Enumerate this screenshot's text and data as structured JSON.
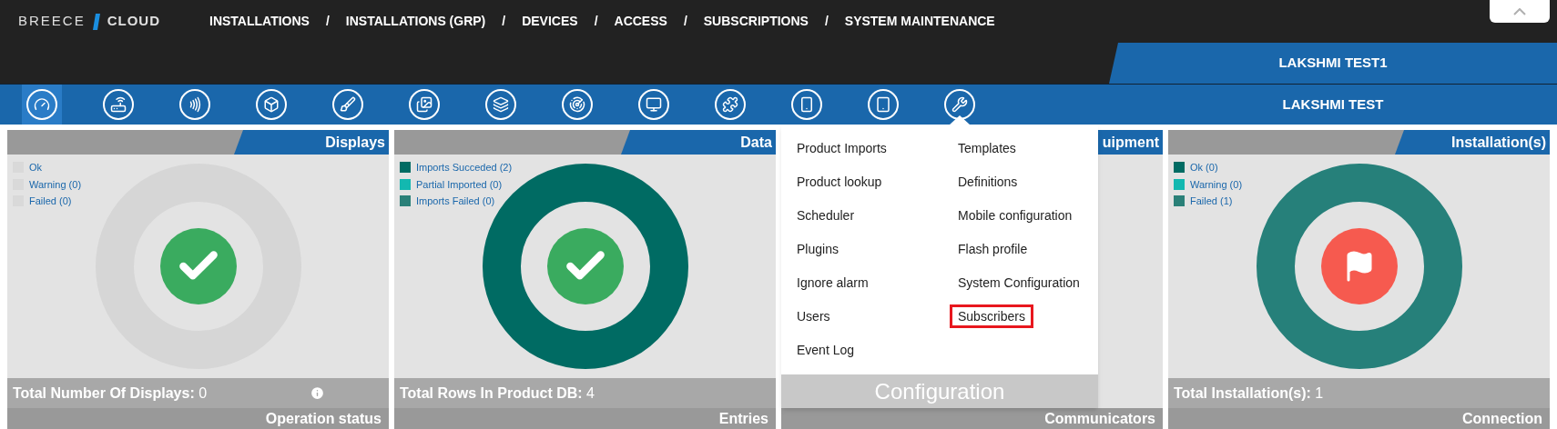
{
  "logo": {
    "left": "BREECE",
    "right": "CLOUD"
  },
  "nav": {
    "separator": "/",
    "items": [
      "INSTALLATIONS",
      "INSTALLATIONS (GRP)",
      "DEVICES",
      "ACCESS",
      "SUBSCRIPTIONS",
      "SYSTEM MAINTENANCE"
    ]
  },
  "account": {
    "group": "LAKSHMI TEST1",
    "site": "LAKSHMI TEST"
  },
  "toolbar": [
    {
      "kind": "gauge",
      "selected": true,
      "expanded": false
    },
    {
      "kind": "router",
      "selected": false,
      "expanded": false
    },
    {
      "kind": "nfc",
      "selected": false,
      "expanded": false
    },
    {
      "kind": "box",
      "selected": false,
      "expanded": false
    },
    {
      "kind": "brush",
      "selected": false,
      "expanded": false
    },
    {
      "kind": "images",
      "selected": false,
      "expanded": false
    },
    {
      "kind": "layers",
      "selected": false,
      "expanded": false
    },
    {
      "kind": "radar",
      "selected": false,
      "expanded": false
    },
    {
      "kind": "monitor",
      "selected": false,
      "expanded": false
    },
    {
      "kind": "puzzle",
      "selected": false,
      "expanded": false
    },
    {
      "kind": "phone",
      "selected": false,
      "expanded": false
    },
    {
      "kind": "tablet",
      "selected": false,
      "expanded": false
    },
    {
      "kind": "wrench",
      "selected": false,
      "expanded": true
    }
  ],
  "cards": [
    {
      "title": "Displays",
      "color": "#d6d6d6",
      "kind": "check",
      "legend": [
        {
          "label": "Ok",
          "color": "#d9d9d9"
        },
        {
          "label": "Warning (0)",
          "color": "#d9d9d9"
        },
        {
          "label": "Failed (0)",
          "color": "#d9d9d9"
        }
      ],
      "total_label": "Total Number Of Displays:",
      "total_value": "0",
      "info": true,
      "footer": "Operation status"
    },
    {
      "title": "Data",
      "color": "#006b63",
      "kind": "check",
      "legend": [
        {
          "label": "Imports Succeded (2)",
          "color": "#006b63"
        },
        {
          "label": "Partial Imported (0)",
          "color": "#13b8b0"
        },
        {
          "label": "Imports Failed (0)",
          "color": "#2a8078"
        }
      ],
      "total_label": "Total Rows In Product DB:",
      "total_value": "4",
      "info": false,
      "footer": "Entries"
    },
    {
      "title": "uipment",
      "footer": "Communicators"
    },
    {
      "title": "Installation(s)",
      "color": "#26807a",
      "kind": "flag",
      "legend": [
        {
          "label": "Ok (0)",
          "color": "#006b63"
        },
        {
          "label": "Warning (0)",
          "color": "#13b8b0"
        },
        {
          "label": "Failed (1)",
          "color": "#2a8078"
        }
      ],
      "total_label": "Total Installation(s):",
      "total_value": "1",
      "info": false,
      "footer": "Connection"
    }
  ],
  "menu": {
    "columns": [
      [
        {
          "label": "Product Imports",
          "selected": false
        },
        {
          "label": "Product lookup",
          "selected": false
        },
        {
          "label": "Scheduler",
          "selected": false
        },
        {
          "label": "Plugins",
          "selected": false
        },
        {
          "label": "Ignore alarm",
          "selected": false
        },
        {
          "label": "Users",
          "selected": false
        },
        {
          "label": "Event Log",
          "selected": false
        }
      ],
      [
        {
          "label": "Templates",
          "selected": false
        },
        {
          "label": "Definitions",
          "selected": false
        },
        {
          "label": "Mobile configuration",
          "selected": false
        },
        {
          "label": "Flash profile",
          "selected": false
        },
        {
          "label": "System Configuration",
          "selected": false
        },
        {
          "label": "Subscribers",
          "selected": true
        }
      ]
    ],
    "footer": "Configuration"
  }
}
